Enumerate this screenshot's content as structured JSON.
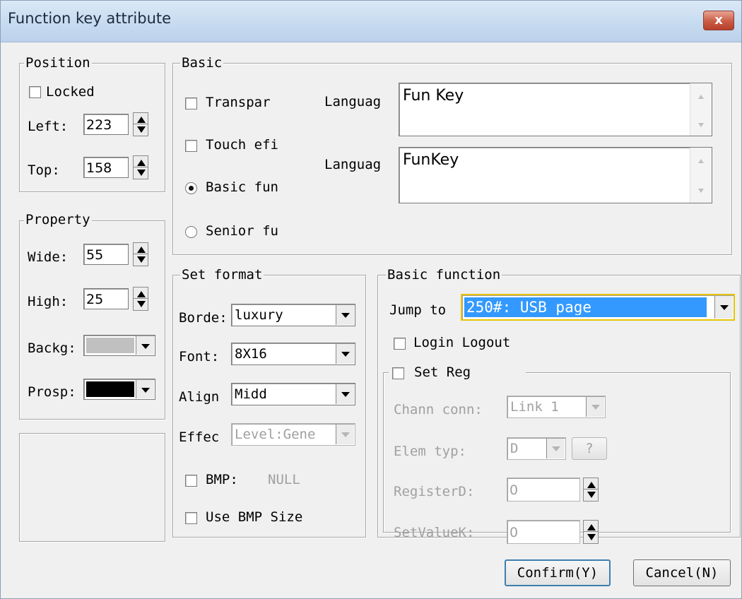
{
  "window": {
    "title": "Function key attribute",
    "close_label": "x"
  },
  "position": {
    "legend": "Position",
    "locked_label": "Locked",
    "locked": false,
    "left_label": "Left:",
    "left_value": "223",
    "top_label": "Top:",
    "top_value": "158"
  },
  "property": {
    "legend": "Property",
    "wide_label": "Wide:",
    "wide_value": "55",
    "high_label": "High:",
    "high_value": "25",
    "backg_label": "Backg:",
    "backg_color": "#c0c0c0",
    "prosp_label": "Prosp:",
    "prosp_color": "#000000"
  },
  "basic": {
    "legend": "Basic",
    "transparent_label": "Transpar",
    "touch_label": "Touch efi",
    "basic_fun_label": "Basic fun",
    "senior_fun_label": "Senior fu",
    "selected_mode": "Basic fun",
    "language1_label": "Languag",
    "language1_text": "Fun Key",
    "language2_label": "Languag",
    "language2_text": "FunKey"
  },
  "set_format": {
    "legend": "Set format",
    "border_label": "Borde:",
    "border_value": "luxury",
    "font_label": "Font:",
    "font_value": "8X16",
    "align_label": "Align",
    "align_value": "Midd",
    "effect_label": "Effec",
    "effect_value": "Level:Gene",
    "bmp_label": "BMP:",
    "bmp_value": "NULL",
    "use_bmp_size_label": "Use BMP Size"
  },
  "basic_function": {
    "legend": "Basic function",
    "jump_to_label": "Jump to",
    "jump_to_value": "250#: USB page",
    "login_logout_label": "Login Logout",
    "set_reg_label": "Set Reg",
    "chann_conn_label": "Chann conn:",
    "chann_conn_value": "Link 1",
    "elem_typ_label": "Elem typ:",
    "elem_typ_value": "D",
    "help_label": "?",
    "register_label": "RegisterD:",
    "register_value": "0",
    "setvalue_label": "SetValueK:",
    "setvalue_value": "0"
  },
  "buttons": {
    "confirm_label": "Confirm(Y)",
    "cancel_label": "Cancel(N)"
  }
}
